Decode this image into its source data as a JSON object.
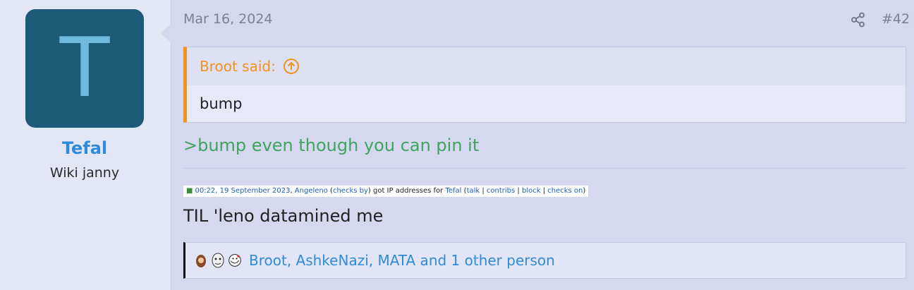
{
  "user": {
    "avatar_letter": "T",
    "name": "Tefal",
    "title": "Wiki janny"
  },
  "post": {
    "date": "Mar 16, 2024",
    "number": "#42",
    "quote": {
      "author_line": "Broot said:",
      "text": "bump"
    },
    "greentext": ">bump even though you can pin it",
    "log": {
      "bullet": "■",
      "time": "00:22, 19 September 2023",
      "comma": ", ",
      "actor": "Angeleno",
      "open_paren": " (",
      "checks_by": "checks by",
      "close_paren_text": ") got IP addresses for ",
      "target": "Tefal",
      "open_paren2": " (",
      "talk": "talk",
      "sep1": " | ",
      "contribs": "contribs",
      "sep2": " | ",
      "block": "block",
      "sep3": " | ",
      "checks_on": "checks on",
      "close_paren2": ")"
    },
    "body": "TIL 'leno datamined me",
    "reactions": {
      "users_text": "Broot, AshkeNazi, MATA and 1 other person"
    }
  },
  "colors": {
    "accent_blue": "#2f8bd9",
    "quote_orange": "#f0921e",
    "greentext": "#3fa45e",
    "avatar_bg": "#1d5a78"
  }
}
